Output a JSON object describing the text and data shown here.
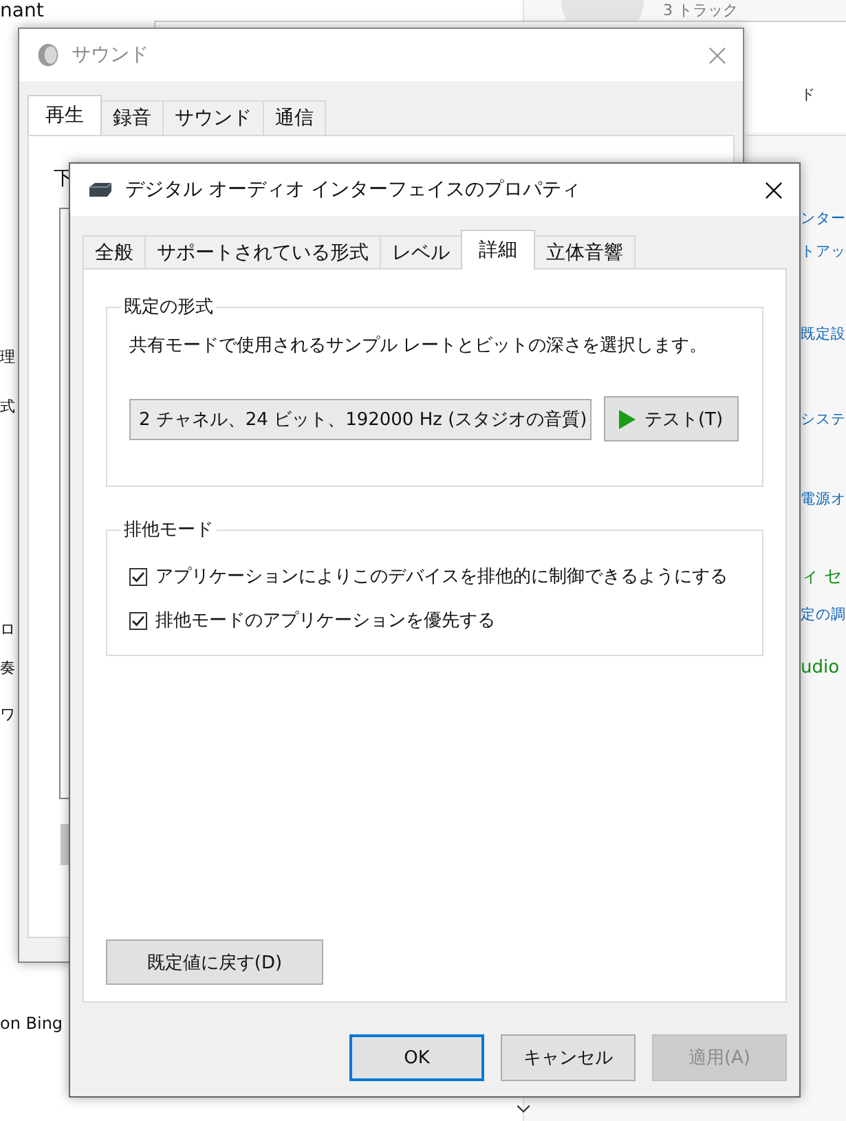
{
  "background": {
    "top_left_text": "nant",
    "track_count": "3 トラック",
    "left_fragments": [
      "理",
      "式",
      "ロ",
      "奏",
      "ワ"
    ],
    "bottom_left_text": "on Bing",
    "right_fragments": [
      {
        "text": "ド",
        "kind": "plain"
      },
      {
        "text": "ンター",
        "kind": "link"
      },
      {
        "text": "トアッ",
        "kind": "link"
      },
      {
        "text": "既定設",
        "kind": "link"
      },
      {
        "text": "システ",
        "kind": "link"
      },
      {
        "text": "電源オ",
        "kind": "link"
      },
      {
        "text": "ィ セ",
        "kind": "heading"
      },
      {
        "text": "定の調",
        "kind": "link"
      },
      {
        "text": "udio",
        "kind": "heading"
      }
    ]
  },
  "sound_window": {
    "title": "サウンド",
    "tabs": [
      {
        "label": "再生",
        "selected": true
      },
      {
        "label": "録音",
        "selected": false
      },
      {
        "label": "サウンド",
        "selected": false
      },
      {
        "label": "通信",
        "selected": false
      }
    ],
    "content_fragment": "下"
  },
  "properties_dialog": {
    "title": "デジタル オーディオ インターフェイスのプロパティ",
    "tabs": [
      {
        "label": "全般",
        "selected": false
      },
      {
        "label": "サポートされている形式",
        "selected": false
      },
      {
        "label": "レベル",
        "selected": false
      },
      {
        "label": "詳細",
        "selected": true
      },
      {
        "label": "立体音響",
        "selected": false
      }
    ],
    "default_format": {
      "title": "既定の形式",
      "description": "共有モードで使用されるサンプル レートとビットの深さを選択します。",
      "format_select": {
        "value": "2 チャネル、24 ビット、192000 Hz (スタジオの音質)"
      },
      "test_button": "テスト(T)"
    },
    "exclusive_mode": {
      "title": "排他モード",
      "options": [
        {
          "label": "アプリケーションによりこのデバイスを排他的に制御できるようにする",
          "checked": true
        },
        {
          "label": "排他モードのアプリケーションを優先する",
          "checked": true
        }
      ]
    },
    "restore_button": "既定値に戻す(D)",
    "buttons": [
      {
        "label": "OK",
        "kind": "default",
        "disabled": false
      },
      {
        "label": "キャンセル",
        "kind": "normal",
        "disabled": false
      },
      {
        "label": "適用(A)",
        "kind": "normal",
        "disabled": true
      }
    ]
  }
}
